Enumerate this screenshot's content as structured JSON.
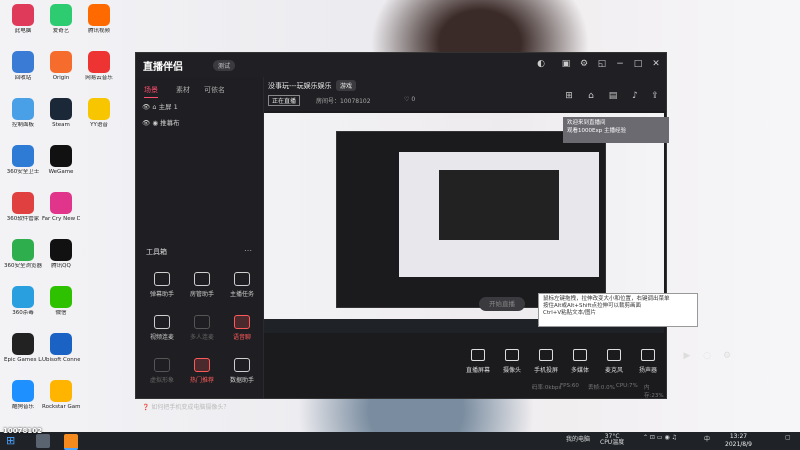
{
  "desktop": {
    "icons": [
      {
        "label": "此电脑",
        "color": "#e03a5a"
      },
      {
        "label": "回收站",
        "color": "#3a7bd5"
      },
      {
        "label": "控制面板",
        "color": "#4aa0e6"
      },
      {
        "label": "360安全卫士",
        "color": "#2e7bd6"
      },
      {
        "label": "360软件管家",
        "color": "#e04040"
      },
      {
        "label": "360安全浏览器",
        "color": "#2fae4e"
      },
      {
        "label": "360杀毒",
        "color": "#2a9fe0"
      },
      {
        "label": "Epic Games Launcher",
        "color": "#222"
      },
      {
        "label": "酷狗音乐",
        "color": "#1e90ff"
      },
      {
        "label": "爱奇艺",
        "color": "#2ecc71"
      },
      {
        "label": "Origin",
        "color": "#f56c2d"
      },
      {
        "label": "Steam",
        "color": "#1b2838"
      },
      {
        "label": "WeGame",
        "color": "#111"
      },
      {
        "label": "Far Cry New Dawn",
        "color": "#e0358a"
      },
      {
        "label": "腾讯QQ",
        "color": "#111"
      },
      {
        "label": "微信",
        "color": "#2dc100"
      },
      {
        "label": "Ubisoft Connect",
        "color": "#1a63c4"
      },
      {
        "label": "Rockstar Games Launcher",
        "color": "#ffb400"
      },
      {
        "label": "腾讯视频",
        "color": "#ff6a00"
      },
      {
        "label": "网易云音乐",
        "color": "#e33"
      },
      {
        "label": "YY语音",
        "color": "#f7c600"
      }
    ]
  },
  "app": {
    "title": "直播伴侣",
    "version": "测试",
    "tabs": [
      "场景",
      "素材",
      "可依名"
    ],
    "scenes": [
      "主屏 1",
      "推幕布"
    ],
    "tools_title": "工具箱",
    "tools": [
      {
        "label": "弹幕助手",
        "state": "normal"
      },
      {
        "label": "房管助手",
        "state": "normal"
      },
      {
        "label": "主播任务",
        "state": "normal"
      },
      {
        "label": "视频连麦",
        "state": "normal"
      },
      {
        "label": "多人连麦",
        "state": "dim"
      },
      {
        "label": "语音聊",
        "state": "red"
      },
      {
        "label": "虚拟形象",
        "state": "dim"
      },
      {
        "label": "热门推荐",
        "state": "red"
      },
      {
        "label": "数据助手",
        "state": "normal"
      }
    ],
    "footer_tip": "如何把手机变成电脑摄像头？",
    "topinfo": {
      "room_title": "没事玩---玩娱乐娱乐",
      "category": "游戏",
      "status": "正在直播",
      "room_label": "房间号：10078102",
      "likes": "0"
    },
    "notice": [
      "欢迎来到直播间",
      "观看1000Exp 主播经验"
    ],
    "bottom_buttons": [
      "直播屏幕",
      "摄像头",
      "手机投屏",
      "多媒体",
      "麦克风",
      "扬声器"
    ],
    "stats": [
      "码率:0kbps",
      "FPS:60",
      "丢帧:0.0%",
      "CPU:7%",
      "内存:23%"
    ],
    "start_live": "开始直播",
    "tooltip": [
      "鼠标左键拖拽，拉伸改变大小和位置，右键调出菜单",
      "按住Alt或Alt+Shift点拉伸可以裁剪画面",
      "Ctrl+V粘贴文本/图片"
    ]
  },
  "taskbar": {
    "tray_text": "我的电脑",
    "temp": "37°C",
    "temp_label": "CPU温度",
    "ime": "中",
    "time": "13:27",
    "date": "2021/8/9"
  },
  "watermark": "10078102"
}
